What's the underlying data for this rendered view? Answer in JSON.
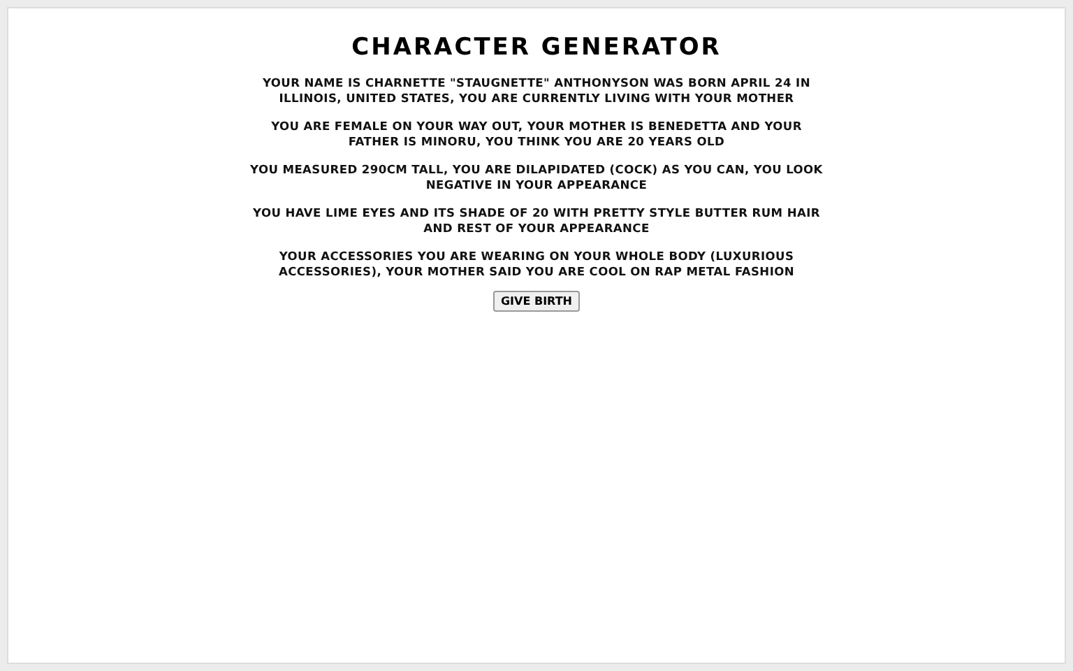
{
  "title": "CHARACTER GENERATOR",
  "paragraphs": [
    "YOUR NAME IS CHARNETTE \"STAUGNETTE\" ANTHONYSON WAS BORN APRIL 24 IN ILLINOIS, UNITED STATES, YOU ARE CURRENTLY LIVING WITH YOUR MOTHER",
    "YOU ARE FEMALE ON YOUR WAY OUT, YOUR MOTHER IS BENEDETTA AND YOUR FATHER IS MINORU, YOU THINK YOU ARE 20 YEARS OLD",
    "YOU MEASURED 290CM TALL, YOU ARE DILAPIDATED (COCK) AS YOU CAN, YOU LOOK NEGATIVE IN YOUR APPEARANCE",
    "YOU HAVE LIME EYES AND ITS SHADE OF 20 WITH PRETTY STYLE BUTTER RUM HAIR AND REST OF YOUR APPEARANCE",
    "YOUR ACCESSORIES YOU ARE WEARING ON YOUR WHOLE BODY (LUXURIOUS ACCESSORIES), YOUR MOTHER SAID YOU ARE COOL ON RAP METAL FASHION"
  ],
  "button": "GIVE BIRTH"
}
